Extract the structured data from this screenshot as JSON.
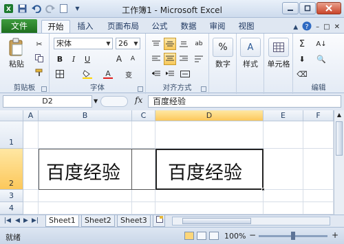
{
  "title": "工作簿1 - Microsoft Excel",
  "tabs": [
    "文件",
    "开始",
    "插入",
    "页面布局",
    "公式",
    "数据",
    "审阅",
    "视图"
  ],
  "ribbon": {
    "clipboard": {
      "paste": "粘贴",
      "label": "剪贴板"
    },
    "font": {
      "name": "宋体",
      "size": "26",
      "label": "字体"
    },
    "alignment": {
      "label": "对齐方式"
    },
    "number": {
      "button": "数字"
    },
    "styles": {
      "button": "样式"
    },
    "cells": {
      "button": "单元格"
    },
    "editing": {
      "label": "编辑"
    }
  },
  "formula_bar": {
    "name_box": "D2",
    "fx": "fx",
    "content": "百度经验"
  },
  "grid": {
    "columns": [
      "A",
      "B",
      "C",
      "D",
      "E",
      "F"
    ],
    "rows": [
      "1",
      "2",
      "3",
      "4"
    ],
    "selected_cell": "D2",
    "cells": {
      "B2": "百度经验",
      "D2": "百度经验"
    }
  },
  "sheets": [
    "Sheet1",
    "Sheet2",
    "Sheet3"
  ],
  "status": {
    "ready": "就绪",
    "zoom": "100%",
    "zoom_percent": 100
  },
  "colors": {
    "file_tab": "#2a7f2a",
    "selection": "#fcc85b"
  },
  "icons": [
    "save-icon",
    "undo-icon",
    "redo-icon",
    "help-icon",
    "minimize-icon",
    "maximize-icon",
    "close-icon"
  ]
}
